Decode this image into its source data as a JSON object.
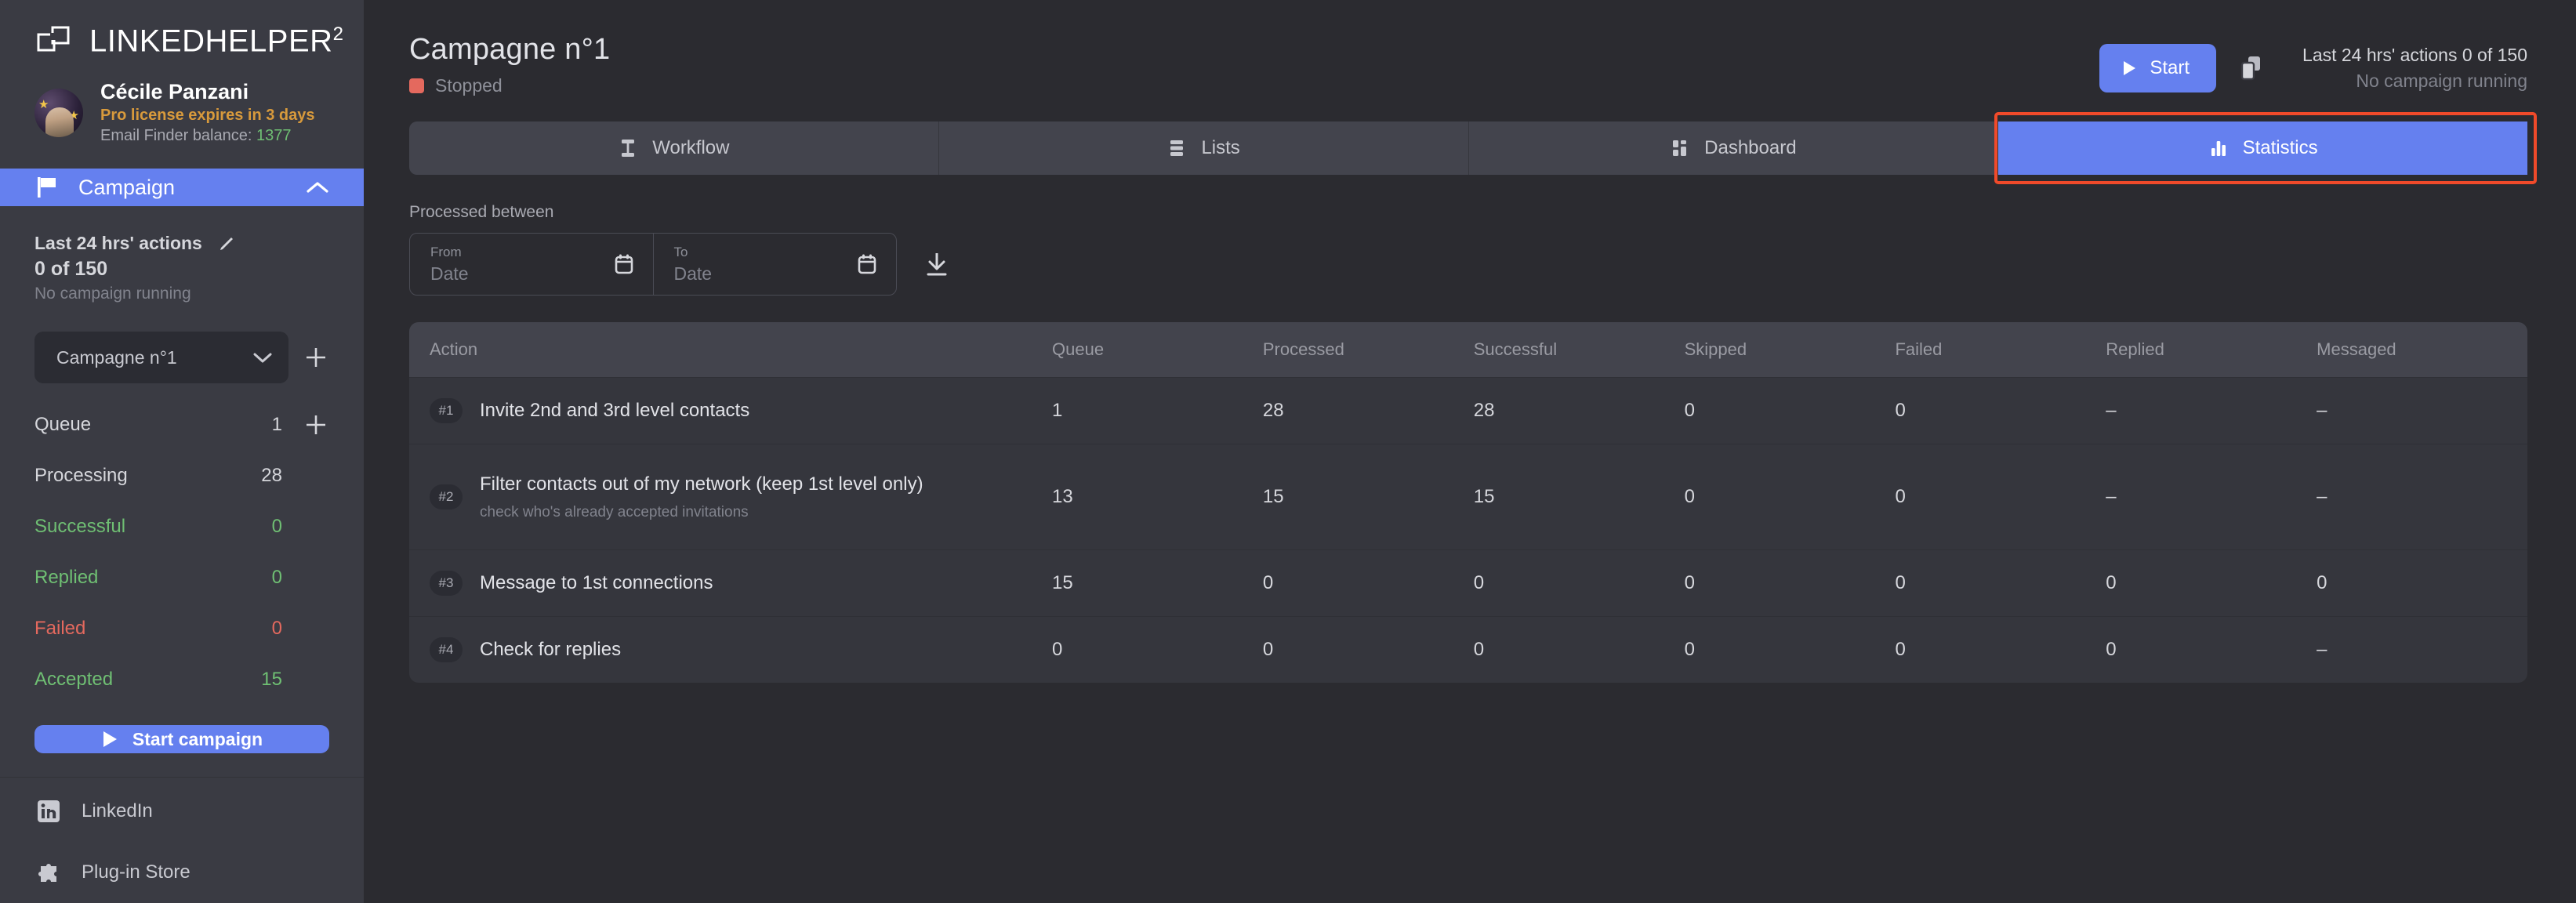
{
  "brand": {
    "name": "LINKEDHELPER",
    "superscript": "2",
    "logo_icon": "linked-squares-icon"
  },
  "profile": {
    "name": "Cécile Panzani",
    "license": "Pro license expires in 3 days",
    "balance_label": "Email Finder balance:",
    "balance_value": "1377"
  },
  "nav": {
    "campaign_label": "Campaign",
    "campaign_icon": "flag-icon",
    "chevron_icon": "chevron-up-icon"
  },
  "sidebar_actions": {
    "title": "Last 24 hrs' actions",
    "edit_icon": "pencil-icon",
    "count": "0 of 150",
    "subtitle": "No campaign running"
  },
  "campaign_select": {
    "value": "Campagne n°1",
    "chevron_icon": "chevron-down-icon",
    "add_icon": "plus-icon"
  },
  "stats": [
    {
      "label": "Queue",
      "value": "1",
      "color": "#d6d7dc",
      "has_add": true,
      "add_icon": "plus-icon"
    },
    {
      "label": "Processing",
      "value": "28",
      "color": "#d6d7dc",
      "has_add": false
    },
    {
      "label": "Successful",
      "value": "0",
      "color": "#6fbf73",
      "has_add": false
    },
    {
      "label": "Replied",
      "value": "0",
      "color": "#6fbf73",
      "has_add": false
    },
    {
      "label": "Failed",
      "value": "0",
      "color": "#e4695e",
      "has_add": false
    },
    {
      "label": "Accepted",
      "value": "15",
      "color": "#6fbf73",
      "has_add": false
    }
  ],
  "start_campaign_button": {
    "label": "Start campaign",
    "icon": "play-icon"
  },
  "bottom_nav": [
    {
      "label": "LinkedIn",
      "icon": "linkedin-icon"
    },
    {
      "label": "Plug-in Store",
      "icon": "puzzle-piece-icon"
    }
  ],
  "header": {
    "title": "Campagne n°1",
    "status": "Stopped",
    "status_color": "#e4695e",
    "start_button": {
      "label": "Start",
      "icon": "play-icon"
    },
    "copy_icon": "copy-icon",
    "meta_line1": "Last 24 hrs' actions 0 of 150",
    "meta_line2": "No campaign running"
  },
  "tabs": [
    {
      "label": "Workflow",
      "icon": "workflow-icon",
      "active": false
    },
    {
      "label": "Lists",
      "icon": "list-icon",
      "active": false
    },
    {
      "label": "Dashboard",
      "icon": "dashboard-icon",
      "active": false
    },
    {
      "label": "Statistics",
      "icon": "bar-chart-icon",
      "active": true
    }
  ],
  "filter": {
    "label": "Processed between",
    "from_caption": "From",
    "from_value": "",
    "from_placeholder": "Date",
    "to_caption": "To",
    "to_value": "",
    "to_placeholder": "Date",
    "calendar_icon": "calendar-icon",
    "download_icon": "download-icon"
  },
  "table": {
    "columns": [
      "Action",
      "Queue",
      "Processed",
      "Successful",
      "Skipped",
      "Failed",
      "Replied",
      "Messaged"
    ],
    "rows": [
      {
        "badge": "#1",
        "title": "Invite 2nd and 3rd level contacts",
        "subtitle": "",
        "queue": "1",
        "processed": "28",
        "successful": "28",
        "skipped": "0",
        "failed": "0",
        "replied": "–",
        "messaged": "–"
      },
      {
        "badge": "#2",
        "title": "Filter contacts out of my network (keep 1st level only)",
        "subtitle": "check who's already accepted invitations",
        "queue": "13",
        "processed": "15",
        "successful": "15",
        "skipped": "0",
        "failed": "0",
        "replied": "–",
        "messaged": "–"
      },
      {
        "badge": "#3",
        "title": "Message to 1st connections",
        "subtitle": "",
        "queue": "15",
        "processed": "0",
        "successful": "0",
        "skipped": "0",
        "failed": "0",
        "replied": "0",
        "messaged": "0"
      },
      {
        "badge": "#4",
        "title": "Check for replies",
        "subtitle": "",
        "queue": "0",
        "processed": "0",
        "successful": "0",
        "skipped": "0",
        "failed": "0",
        "replied": "0",
        "messaged": "–"
      }
    ]
  },
  "theme": {
    "accent": "#6580ef",
    "danger": "#e4695e",
    "success": "#6fbf73",
    "warning": "#d89a3c",
    "highlight_box": "#f04a2a"
  }
}
